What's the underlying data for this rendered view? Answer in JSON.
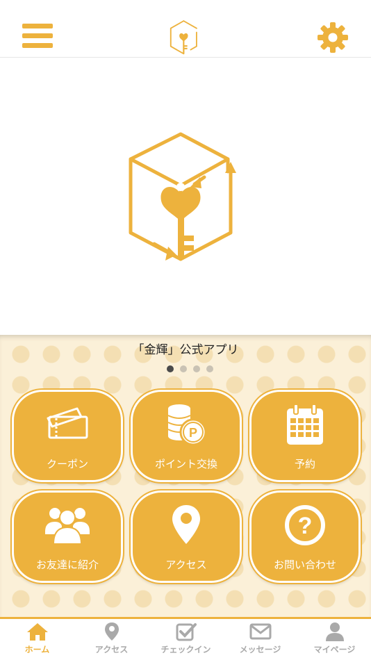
{
  "colors": {
    "accent": "#EDB23D",
    "tab_inactive": "#A9A9A9"
  },
  "header": {
    "menu_icon": "hamburger-menu-icon",
    "logo_icon": "cube-key-logo",
    "settings_icon": "gear-icon"
  },
  "hero": {
    "logo_icon": "cube-key-logo"
  },
  "panel": {
    "title": "「金輝」公式アプリ",
    "page_count": 4,
    "active_page": 1,
    "tiles": [
      {
        "label": "クーポン",
        "icon": "coupon-ticket-icon"
      },
      {
        "label": "ポイント交換",
        "icon": "coin-stack-point-icon"
      },
      {
        "label": "予約",
        "icon": "calendar-icon"
      },
      {
        "label": "お友達に紹介",
        "icon": "people-group-icon"
      },
      {
        "label": "アクセス",
        "icon": "location-pin-icon"
      },
      {
        "label": "お問い合わせ",
        "icon": "question-circle-icon"
      }
    ]
  },
  "tabbar": {
    "tabs": [
      {
        "label": "ホーム",
        "icon": "home-icon",
        "active": true
      },
      {
        "label": "アクセス",
        "icon": "location-pin-icon",
        "active": false
      },
      {
        "label": "チェックイン",
        "icon": "checkin-icon",
        "active": false
      },
      {
        "label": "メッセージ",
        "icon": "envelope-icon",
        "active": false
      },
      {
        "label": "マイページ",
        "icon": "user-icon",
        "active": false
      }
    ]
  }
}
